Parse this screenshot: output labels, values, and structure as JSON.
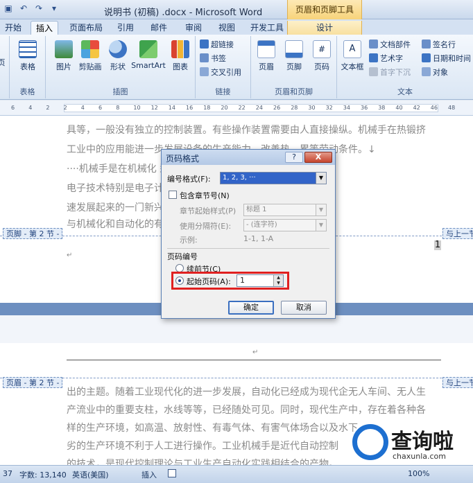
{
  "window": {
    "title": "说明书 (初稿) .docx - Microsoft Word",
    "context_tab_title": "页眉和页脚工具"
  },
  "tabs": [
    "开始",
    "插入",
    "页面布局",
    "引用",
    "邮件",
    "审阅",
    "视图",
    "开发工具",
    "设计"
  ],
  "ribbon": {
    "partial_left": "页",
    "table": {
      "label": "表格",
      "group": "表格"
    },
    "illustrations": {
      "items": [
        "图片",
        "剪贴画",
        "形状",
        "SmartArt",
        "图表"
      ],
      "group": "插图"
    },
    "links": {
      "items": [
        "超链接",
        "书签",
        "交叉引用"
      ],
      "group": "链接"
    },
    "header_footer": {
      "items": [
        "页眉",
        "页脚",
        "页码"
      ],
      "group": "页眉和页脚"
    },
    "text": {
      "textbox": "文本框",
      "items": [
        "文档部件",
        "艺术字",
        "首字下沉",
        "签名行",
        "日期和时间",
        "对象"
      ],
      "group": "文本"
    }
  },
  "ruler": {
    "numbers": [
      "6",
      "4",
      "2",
      "2",
      "4",
      "6",
      "8",
      "10",
      "12",
      "14",
      "16",
      "18",
      "20",
      "22",
      "24",
      "26",
      "28",
      "30",
      "32",
      "34",
      "36",
      "38",
      "40",
      "42",
      "46",
      "48"
    ]
  },
  "document": {
    "lines_top": [
      "具等，一般没有独立的控制装置。有些操作装置需要由人直接操纵。机械手在热锻挤",
      "工业中的应用能进一步发展设备的生产能力，改善热、累等劳动条件。↓",
      "····机械手是在机械化                              型装置。近年来，随着",
      "电子技术特别是电子计                              已成为高技术领域内迅",
      "速发展起来的一门新兴                              使得机械手能更好地实现",
      "与机械化和自动化的有                              械化、自动化已成为实"
    ],
    "footer_tag": "页脚 - 第 2 节 -",
    "same_as_prev": "与上一节",
    "page_number": "1",
    "return_mark": "↵",
    "header_tag": "页眉 - 第 2 节 -",
    "lines_bottom": [
      "出的主题。随着工业现代化的进一步发展，自动化已经成为现代企无人车间、无人生",
      "产流业中的重要支柱，水线等等，已经随处可见。同时，现代生产中，存在着各种各",
      "样的生产环境，如高温、放射性、有毒气体、有害气体场合以及水下    ",
      "劣的生产环境不利于人工进行操作。工业机械手是近代自动控制",
      "的技术，是现代控制理论与工业生产自动化实践相结合的产物。"
    ]
  },
  "dialog": {
    "title": "页码格式",
    "help": "?",
    "close": "X",
    "number_format_label": "编号格式(F):",
    "number_format_value": "1, 2, 3, ···",
    "include_chapter_label": "包含章节号(N)",
    "chapter_style_label": "章节起始样式(P)",
    "chapter_style_value": "标题 1",
    "separator_label": "使用分隔符(E):",
    "separator_value": "-  (连字符)",
    "example_label": "示例:",
    "example_value": "1-1, 1-A",
    "numbering_section": "页码编号",
    "continue_label": "续前节(C)",
    "start_at_label": "起始页码(A):",
    "start_at_value": "1",
    "ok": "确定",
    "cancel": "取消"
  },
  "status": {
    "page": "37",
    "words": "字数: 13,140",
    "language": "英语(美国)",
    "mode": "插入",
    "zoom": "100%"
  },
  "watermark": {
    "text": "查询啦",
    "url": "chaxunla.com"
  },
  "colors": {
    "accent": "#3264c8",
    "highlight": "#e02020",
    "context_tab": "#f7d37a"
  }
}
